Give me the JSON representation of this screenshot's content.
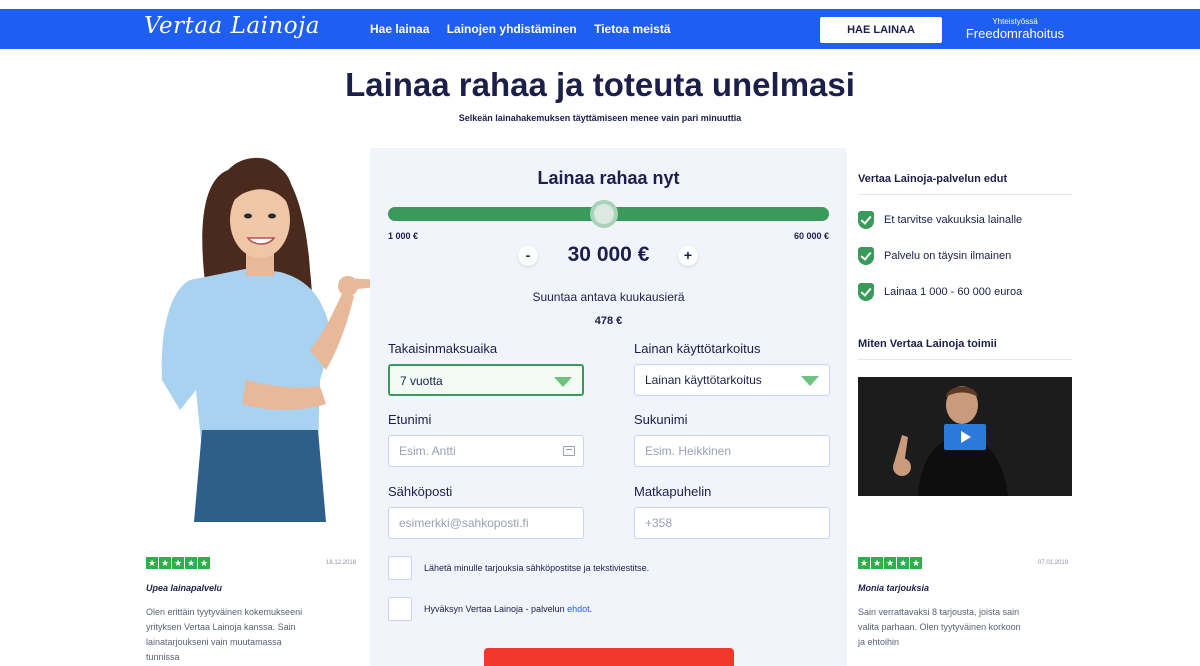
{
  "header": {
    "logo": "Vertaa Lainoja",
    "nav": [
      "Hae lainaa",
      "Lainojen yhdistäminen",
      "Tietoa meistä"
    ],
    "cta": "HAE LAINAA",
    "partner_small": "Yhteistyössä",
    "partner_name": "Freedomrahoitus"
  },
  "hero": {
    "title": "Lainaa rahaa ja toteuta unelmasi",
    "subtitle": "Selkeän lainahakemuksen täyttämiseen menee vain pari minuuttia"
  },
  "form": {
    "title": "Lainaa rahaa nyt",
    "slider_min": "1 000 €",
    "slider_max": "60 000 €",
    "slider_fraction": 0.49,
    "minus": "-",
    "plus": "+",
    "amount": "30 000 €",
    "monthly_label": "Suuntaa antava kuukausierä",
    "monthly_value": "478 €",
    "repayment_label": "Takaisinmaksuaika",
    "repayment_value": "7 vuotta",
    "purpose_label": "Lainan käyttötarkoitus",
    "purpose_value": "Lainan käyttötarkoitus",
    "firstname_label": "Etunimi",
    "firstname_placeholder": "Esim. Antti",
    "lastname_label": "Sukunimi",
    "lastname_placeholder": "Esim. Heikkinen",
    "email_label": "Sähköposti",
    "email_placeholder": "esimerkki@sahkoposti.fi",
    "phone_label": "Matkapuhelin",
    "phone_placeholder": "+358",
    "consent_marketing": "Lähetä minulle tarjouksia sähköpostitse ja tekstiviestitse.",
    "consent_terms": "Hyväksyn Vertaa Lainoja - palvelun ",
    "consent_terms_link": "ehdot",
    "consent_terms_end": "."
  },
  "benefits": {
    "title": "Vertaa Lainoja-palvelun edut",
    "items": [
      "Et tarvitse vakuuksia lainalle",
      "Palvelu on täysin ilmainen",
      "Lainaa 1 000 - 60 000 euroa"
    ],
    "how_title": "Miten Vertaa Lainoja toimii"
  },
  "reviews": {
    "left": {
      "date": "18.12.2018",
      "title": "Upea lainapalvelu",
      "lines": [
        "Olen erittäin tyytyväinen kokemukseeni",
        "yrityksen Vertaa Lainoja kanssa. Sain",
        "lainatarjoukseni vain muutamassa",
        "tunnissa"
      ]
    },
    "right": {
      "date": "07.01.2019",
      "title": "Monia tarjouksia",
      "lines": [
        "Sain verrattavaksi 8 tarjousta, joista sain",
        "valita parhaan. Olen tyytyväinen korkoon",
        "ja ehtoihin"
      ]
    }
  },
  "colors": {
    "brand_blue": "#1e5ff2",
    "navy": "#1b1f4a",
    "green": "#3a9a5b",
    "submit_red": "#f2382b"
  }
}
